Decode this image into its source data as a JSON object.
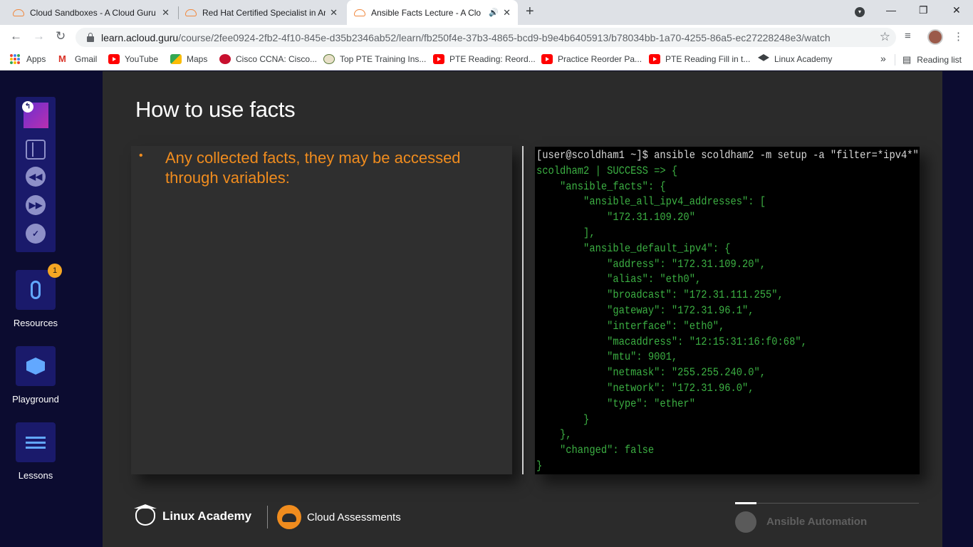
{
  "browser": {
    "tabs": [
      {
        "title": "Cloud Sandboxes - A Cloud Guru",
        "close": "✕"
      },
      {
        "title": "Red Hat Certified Specialist in An",
        "close": "✕"
      },
      {
        "title": "Ansible Facts Lecture - A Clo",
        "close": "✕",
        "audio": "🔊"
      }
    ],
    "new_tab": "+",
    "window_controls": {
      "minimize": "—",
      "maximize": "❐",
      "close": "✕"
    },
    "url_host": "learn.acloud.guru",
    "url_path": "/course/2fee0924-2fb2-4f10-845e-d35b2346ab52/learn/fb250f4e-37b3-4865-bcd9-b9e4b6405913/b78034bb-1a70-4255-86a5-ec27228248e3/watch",
    "bookmarks": [
      {
        "label": "Apps",
        "icon": "apps-icon"
      },
      {
        "label": "Gmail",
        "icon": "gmail-icon"
      },
      {
        "label": "YouTube",
        "icon": "youtube-icon"
      },
      {
        "label": "Maps",
        "icon": "maps-icon"
      },
      {
        "label": "Cisco CCNA: Cisco...",
        "icon": "cisco-icon"
      },
      {
        "label": "Top PTE Training Ins...",
        "icon": "pte-icon"
      },
      {
        "label": "PTE Reading: Reord...",
        "icon": "youtube-icon"
      },
      {
        "label": "Practice Reorder Pa...",
        "icon": "youtube-icon"
      },
      {
        "label": "PTE Reading Fill in t...",
        "icon": "youtube-icon"
      },
      {
        "label": "Linux Academy",
        "icon": "linux-academy-icon"
      }
    ],
    "bookmarks_more": "»",
    "reading_list": "Reading list"
  },
  "sidebar": {
    "resources_label": "Resources",
    "resources_badge": "1",
    "playground_label": "Playground",
    "lessons_label": "Lessons"
  },
  "slide": {
    "title": "How to use facts",
    "bullet": "Any collected facts, they may be accessed through variables:",
    "terminal": [
      "[user@scoldham1 ~]$ ansible scoldham2 -m setup -a \"filter=*ipv4*\"",
      "scoldham2 | SUCCESS => {",
      "    \"ansible_facts\": {",
      "        \"ansible_all_ipv4_addresses\": [",
      "            \"172.31.109.20\"",
      "        ],",
      "        \"ansible_default_ipv4\": {",
      "            \"address\": \"172.31.109.20\",",
      "            \"alias\": \"eth0\",",
      "            \"broadcast\": \"172.31.111.255\",",
      "            \"gateway\": \"172.31.96.1\",",
      "            \"interface\": \"eth0\",",
      "            \"macaddress\": \"12:15:31:16:f0:68\",",
      "            \"mtu\": 9001,",
      "            \"netmask\": \"255.255.240.0\",",
      "            \"network\": \"172.31.96.0\",",
      "            \"type\": \"ether\"",
      "        }",
      "    },",
      "    \"changed\": false",
      "}"
    ],
    "footer_brand_1": "Linux Academy",
    "footer_brand_2": "Cloud Assessments",
    "course_name": "Ansible Automation"
  },
  "colors": {
    "accent_orange": "#f08c1e",
    "terminal_green": "#3cb043",
    "nav_blue": "#1a1a6b",
    "icon_blue": "#62a8ff"
  }
}
